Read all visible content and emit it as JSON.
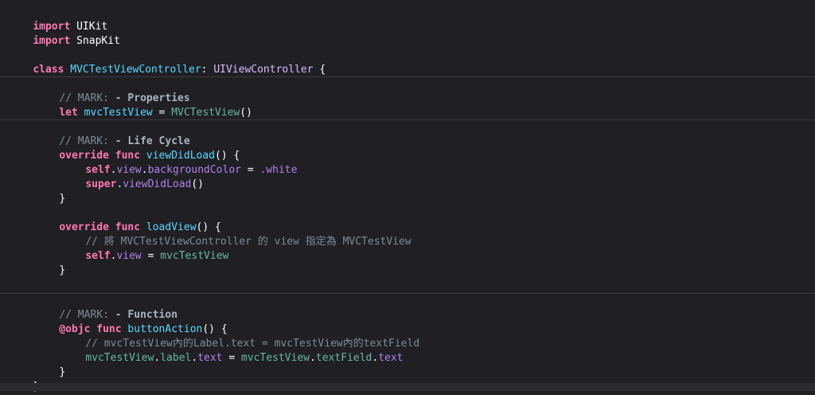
{
  "code": {
    "l1": {
      "kw": "import",
      "mod": "UIKit"
    },
    "l2": {
      "kw": "import",
      "mod": "SnapKit"
    },
    "l4": {
      "kw": "class",
      "name": "MVCTestViewController",
      "colon": ":",
      "super": "UIViewController",
      "brace": "{"
    },
    "l6": {
      "prefix": "// MARK: ",
      "title": "- Properties"
    },
    "l7": {
      "kw": "let",
      "name": "mvcTestView",
      "eq": "=",
      "type": "MVCTestView",
      "call": "()"
    },
    "l9": {
      "prefix": "// MARK: ",
      "title": "- Life Cycle"
    },
    "l10": {
      "kw1": "override",
      "kw2": "func",
      "name": "viewDidLoad",
      "rest": "() {"
    },
    "l11": {
      "self": "self",
      "dot1": ".",
      "view": "view",
      "dot2": ".",
      "prop": "backgroundColor",
      "eq": " = ",
      "val": ".white"
    },
    "l12": {
      "super": "super",
      "dot": ".",
      "method": "viewDidLoad",
      "rest": "()"
    },
    "l13": {
      "brace": "}"
    },
    "l15": {
      "kw1": "override",
      "kw2": "func",
      "name": "loadView",
      "rest": "() {"
    },
    "l16": {
      "comment": "// 將 MVCTestViewController 的 view 指定為 MVCTestView"
    },
    "l17": {
      "self": "self",
      "dot": ".",
      "view": "view",
      "eq": " = ",
      "val": "mvcTestView"
    },
    "l18": {
      "brace": "}"
    },
    "l21": {
      "prefix": "// MARK: ",
      "title": "- Function"
    },
    "l22": {
      "attr": "@objc",
      "kw": "func",
      "name": "buttonAction",
      "rest": "() {"
    },
    "l23": {
      "comment": "// mvcTestView內的Label.text = mvcTestView內的textField"
    },
    "l24": {
      "a": "mvcTestView",
      "d1": ".",
      "b": "label",
      "d2": ".",
      "c": "text",
      "eq": " = ",
      "e": "mvcTestView",
      "d3": ".",
      "f": "textField",
      "d4": ".",
      "g": "text"
    },
    "l25": {
      "brace": "}"
    },
    "l26": {
      "brace": "}"
    }
  }
}
